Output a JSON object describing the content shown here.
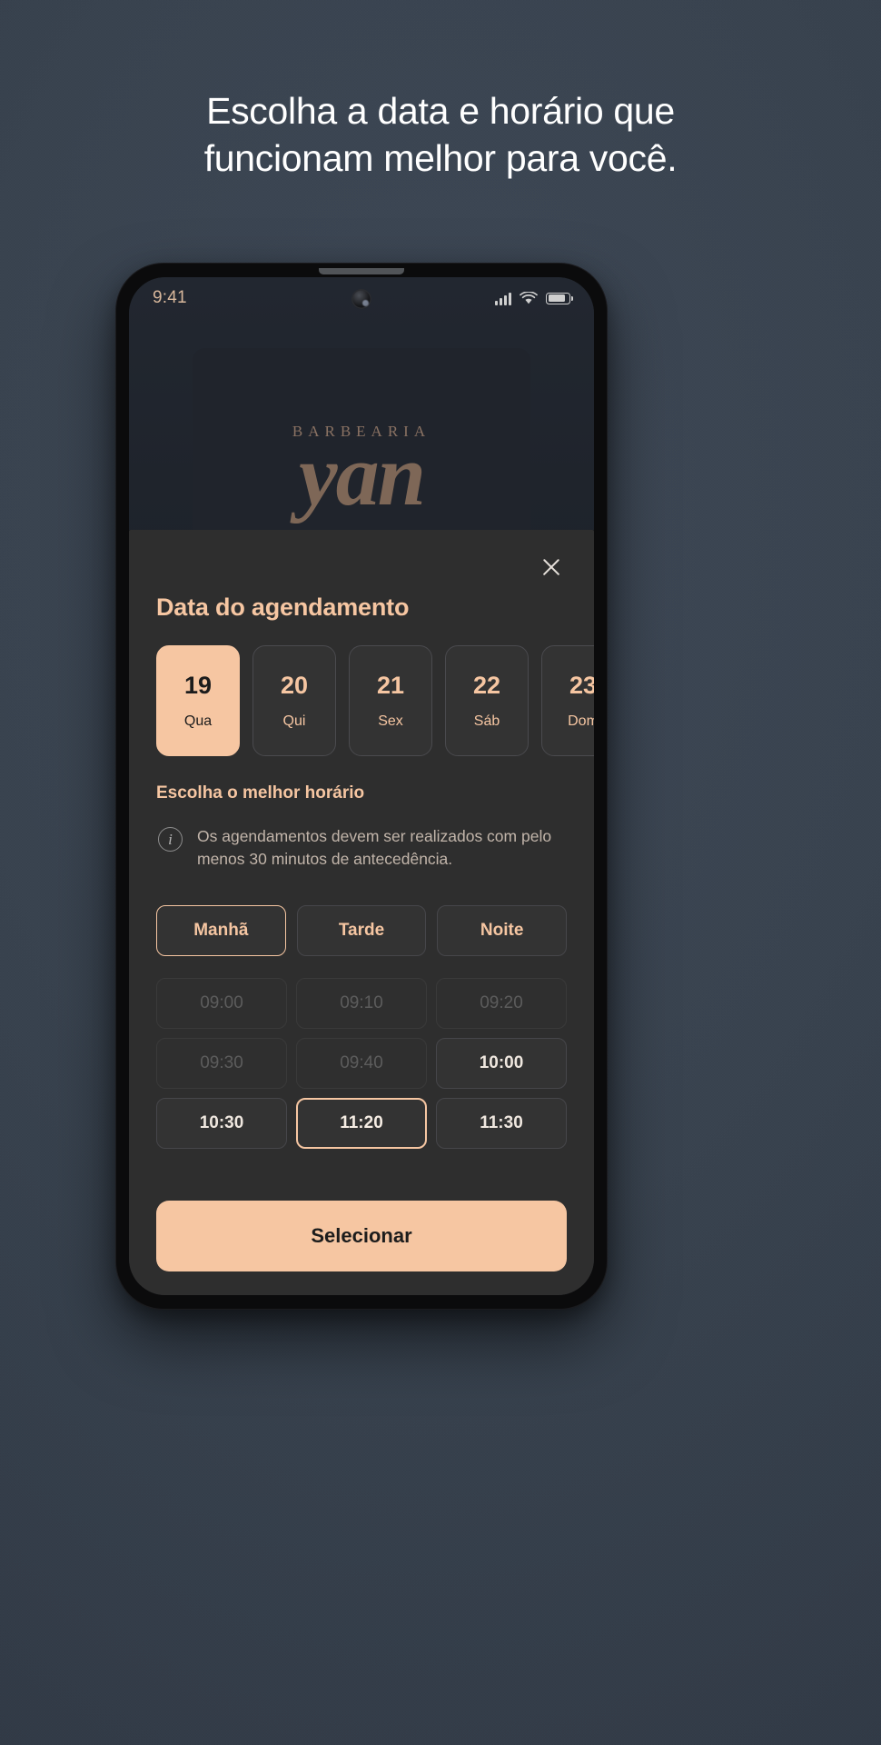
{
  "headline": {
    "line1": "Escolha a data e horário que",
    "line2": "funcionam melhor para você."
  },
  "phone": {
    "status_bar": {
      "time": "9:41",
      "signal_icon": "signal-bars-icon",
      "wifi_icon": "wifi-icon",
      "battery_icon": "battery-icon"
    },
    "hero": {
      "logo_arc": "BARBEARIA",
      "logo_word": "yan"
    }
  },
  "sheet": {
    "close_label": "×",
    "title": "Data do agendamento",
    "dates": [
      {
        "day_number": "19",
        "weekday": "Qua",
        "selected": true
      },
      {
        "day_number": "20",
        "weekday": "Qui",
        "selected": false
      },
      {
        "day_number": "21",
        "weekday": "Sex",
        "selected": false
      },
      {
        "day_number": "22",
        "weekday": "Sáb",
        "selected": false
      },
      {
        "day_number": "23",
        "weekday": "Dom",
        "selected": false
      }
    ],
    "time_section_label": "Escolha o melhor horário",
    "info_note": {
      "icon": "info-circle-icon",
      "text": "Os agendamentos devem ser realizados com pelo menos 30 minutos de antecedência."
    },
    "periods": [
      {
        "label": "Manhã",
        "active": true
      },
      {
        "label": "Tarde",
        "active": false
      },
      {
        "label": "Noite",
        "active": false
      }
    ],
    "slots": [
      {
        "time": "09:00",
        "state": "disabled"
      },
      {
        "time": "09:10",
        "state": "disabled"
      },
      {
        "time": "09:20",
        "state": "disabled"
      },
      {
        "time": "09:30",
        "state": "disabled"
      },
      {
        "time": "09:40",
        "state": "disabled"
      },
      {
        "time": "10:00",
        "state": "available"
      },
      {
        "time": "10:30",
        "state": "available"
      },
      {
        "time": "11:20",
        "state": "selected"
      },
      {
        "time": "11:30",
        "state": "available"
      }
    ],
    "cta_label": "Selecionar"
  },
  "colors": {
    "accent": "#F6C6A2",
    "sheet_bg": "#2E2E2E",
    "page_bg": "#39434F",
    "logo": "#7E6757"
  }
}
